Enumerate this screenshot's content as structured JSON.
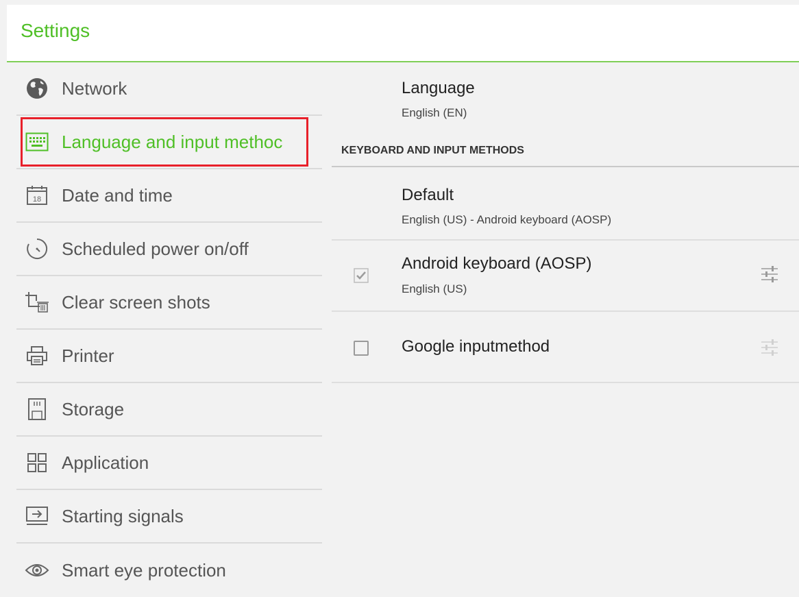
{
  "header": {
    "title": "Settings"
  },
  "sidebar": {
    "items": [
      {
        "label": "Network",
        "icon": "globe-icon"
      },
      {
        "label": "Language and input methoc",
        "icon": "keyboard-icon"
      },
      {
        "label": "Date and time",
        "icon": "calendar-icon",
        "icon_text": "18"
      },
      {
        "label": "Scheduled power on/off",
        "icon": "timer-icon"
      },
      {
        "label": "Clear screen shots",
        "icon": "crop-trash-icon"
      },
      {
        "label": "Printer",
        "icon": "printer-icon"
      },
      {
        "label": "Storage",
        "icon": "sd-card-icon"
      },
      {
        "label": "Application",
        "icon": "grid-icon"
      },
      {
        "label": "Starting signals",
        "icon": "input-signal-icon"
      },
      {
        "label": "Smart eye protection",
        "icon": "eye-icon"
      }
    ],
    "active_index": 1,
    "active_color": "#4fbf26",
    "highlight_color": "#e8202a"
  },
  "main": {
    "language": {
      "title": "Language",
      "value": "English (EN)"
    },
    "section_header": "KEYBOARD AND INPUT METHODS",
    "default": {
      "title": "Default",
      "value": "English (US) - Android keyboard (AOSP)"
    },
    "methods": [
      {
        "title": "Android keyboard (AOSP)",
        "subtitle": "English (US)",
        "checked": true,
        "settings_icon": "sliders-icon"
      },
      {
        "title": "Google inputmethod",
        "checked": false,
        "settings_icon": "sliders-icon"
      }
    ]
  }
}
